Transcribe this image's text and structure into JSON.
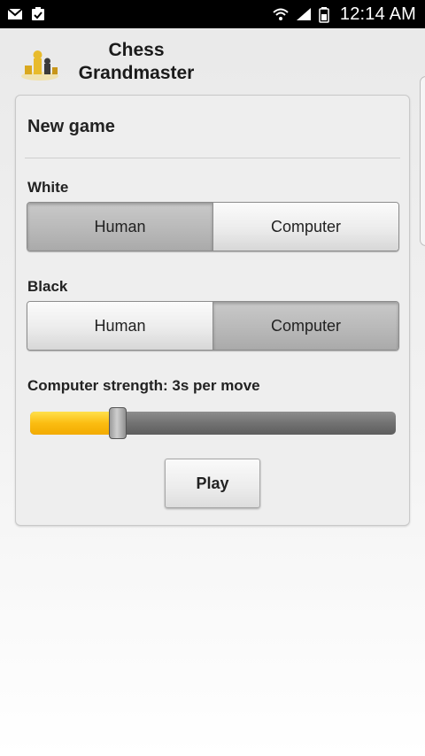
{
  "status_bar": {
    "left_icons": [
      "gmail-icon",
      "clipboard-check-icon"
    ],
    "right_icons": [
      "wifi-icon",
      "signal-icon",
      "battery-icon"
    ],
    "time": "12:14 AM"
  },
  "header": {
    "title_line1": "Chess",
    "title_line2": "Grandmaster",
    "logo_icon": "chess-pieces-logo"
  },
  "card": {
    "title": "New game",
    "white": {
      "label": "White",
      "options": [
        "Human",
        "Computer"
      ],
      "selected": "Human"
    },
    "black": {
      "label": "Black",
      "options": [
        "Human",
        "Computer"
      ],
      "selected": "Computer"
    },
    "strength": {
      "label": "Computer strength: 3s per move",
      "fraction": 0.24
    },
    "play_label": "Play"
  },
  "colors": {
    "accent": "#fbbd12",
    "status_bar": "#000000",
    "track": "#727272"
  }
}
